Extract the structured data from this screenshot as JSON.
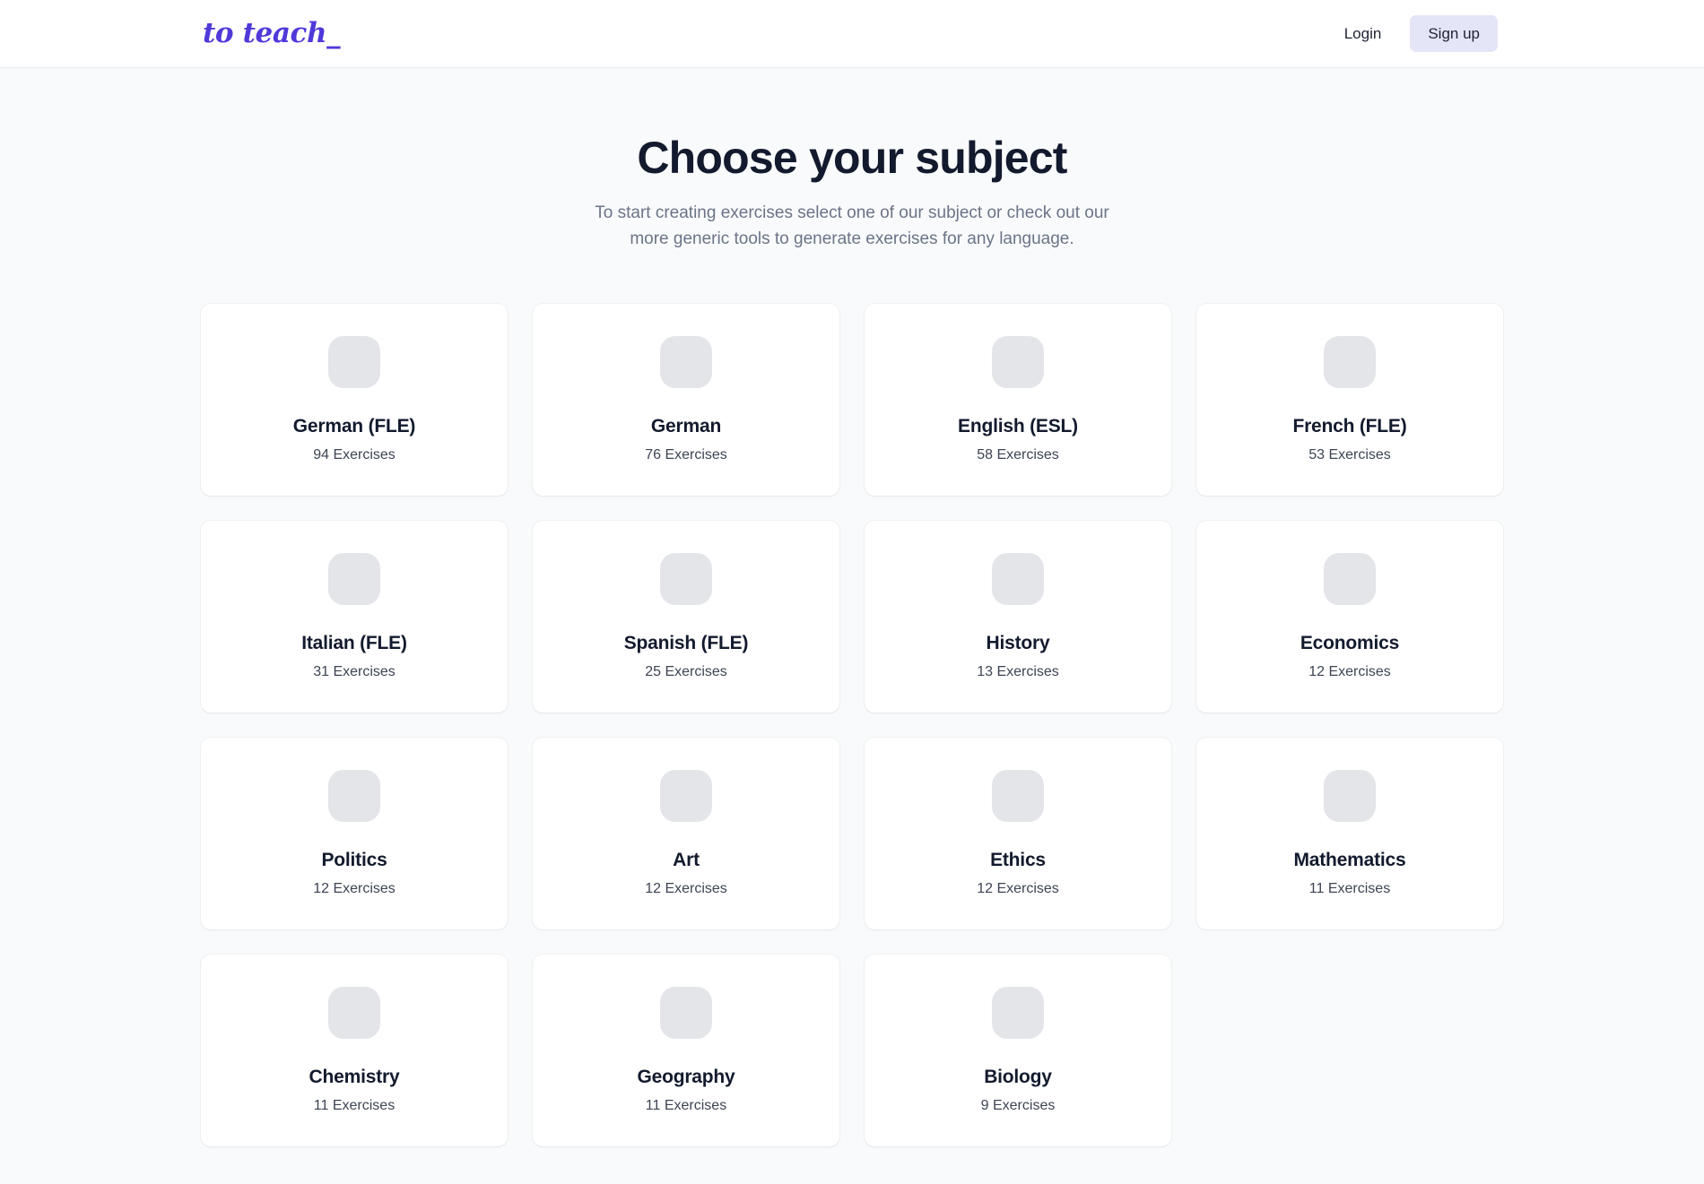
{
  "header": {
    "brand": "to teach",
    "brand_caret": "_",
    "login_label": "Login",
    "signup_label": "Sign up",
    "brand_color": "#4f39d9",
    "signup_bg": "#e4e5f7"
  },
  "main": {
    "title": "Choose your subject",
    "subtitle": "To start creating exercises select one of our subject or check out our more generic tools to generate exercises for any language."
  },
  "subjects": [
    {
      "name": "German (FLE)",
      "count": "94 Exercises",
      "icon": "subject-placeholder-icon"
    },
    {
      "name": "German",
      "count": "76 Exercises",
      "icon": "subject-placeholder-icon"
    },
    {
      "name": "English (ESL)",
      "count": "58 Exercises",
      "icon": "subject-placeholder-icon"
    },
    {
      "name": "French (FLE)",
      "count": "53 Exercises",
      "icon": "subject-placeholder-icon"
    },
    {
      "name": "Italian (FLE)",
      "count": "31 Exercises",
      "icon": "subject-placeholder-icon"
    },
    {
      "name": "Spanish (FLE)",
      "count": "25 Exercises",
      "icon": "subject-placeholder-icon"
    },
    {
      "name": "History",
      "count": "13 Exercises",
      "icon": "subject-placeholder-icon"
    },
    {
      "name": "Economics",
      "count": "12 Exercises",
      "icon": "subject-placeholder-icon"
    },
    {
      "name": "Politics",
      "count": "12 Exercises",
      "icon": "subject-placeholder-icon"
    },
    {
      "name": "Art",
      "count": "12 Exercises",
      "icon": "subject-placeholder-icon"
    },
    {
      "name": "Ethics",
      "count": "12 Exercises",
      "icon": "subject-placeholder-icon"
    },
    {
      "name": "Mathematics",
      "count": "11 Exercises",
      "icon": "subject-placeholder-icon"
    },
    {
      "name": "Chemistry",
      "count": "11 Exercises",
      "icon": "subject-placeholder-icon"
    },
    {
      "name": "Geography",
      "count": "11 Exercises",
      "icon": "subject-placeholder-icon"
    },
    {
      "name": "Biology",
      "count": "9 Exercises",
      "icon": "subject-placeholder-icon"
    }
  ]
}
